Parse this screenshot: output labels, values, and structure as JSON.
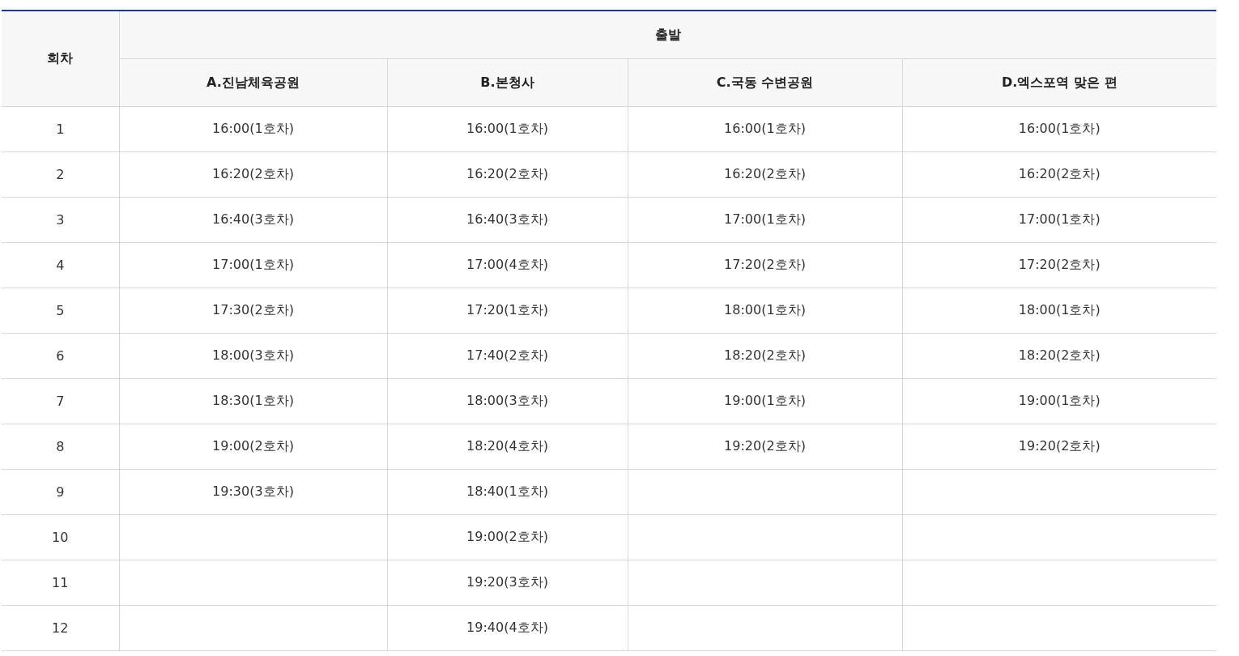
{
  "table": {
    "round_header": "회차",
    "group_header": "출발",
    "rounds": [
      "1",
      "2",
      "3",
      "4",
      "5",
      "6",
      "7",
      "8",
      "9",
      "10",
      "11",
      "12"
    ],
    "columns": [
      {
        "name": "A.진남체육공원",
        "times": [
          "16:00(1호차)",
          "16:20(2호차)",
          "16:40(3호차)",
          "17:00(1호차)",
          "17:30(2호차)",
          "18:00(3호차)",
          "18:30(1호차)",
          "19:00(2호차)",
          "19:30(3호차)"
        ]
      },
      {
        "name": "B.본청사",
        "times": [
          "16:00(1호차)",
          "16:20(2호차)",
          "16:40(3호차)",
          "17:00(4호차)",
          "17:20(1호차)",
          "17:40(2호차)",
          "18:00(3호차)",
          "18:20(4호차)",
          "18:40(1호차)",
          "19:00(2호차)",
          "19:20(3호차)",
          "19:40(4호차)"
        ]
      },
      {
        "name": "C.국동 수변공원",
        "times": [
          "16:00(1호차)",
          "16:20(2호차)",
          "17:00(1호차)",
          "17:20(2호차)",
          "18:00(1호차)",
          "18:20(2호차)",
          "19:00(1호차)",
          "19:20(2호차)"
        ]
      },
      {
        "name": "D.엑스포역 맞은 편",
        "times": [
          "16:00(1호차)",
          "16:20(2호차)",
          "17:00(1호차)",
          "17:20(2호차)",
          "18:00(1호차)",
          "18:20(2호차)",
          "19:00(1호차)",
          "19:20(2호차)"
        ]
      }
    ]
  }
}
